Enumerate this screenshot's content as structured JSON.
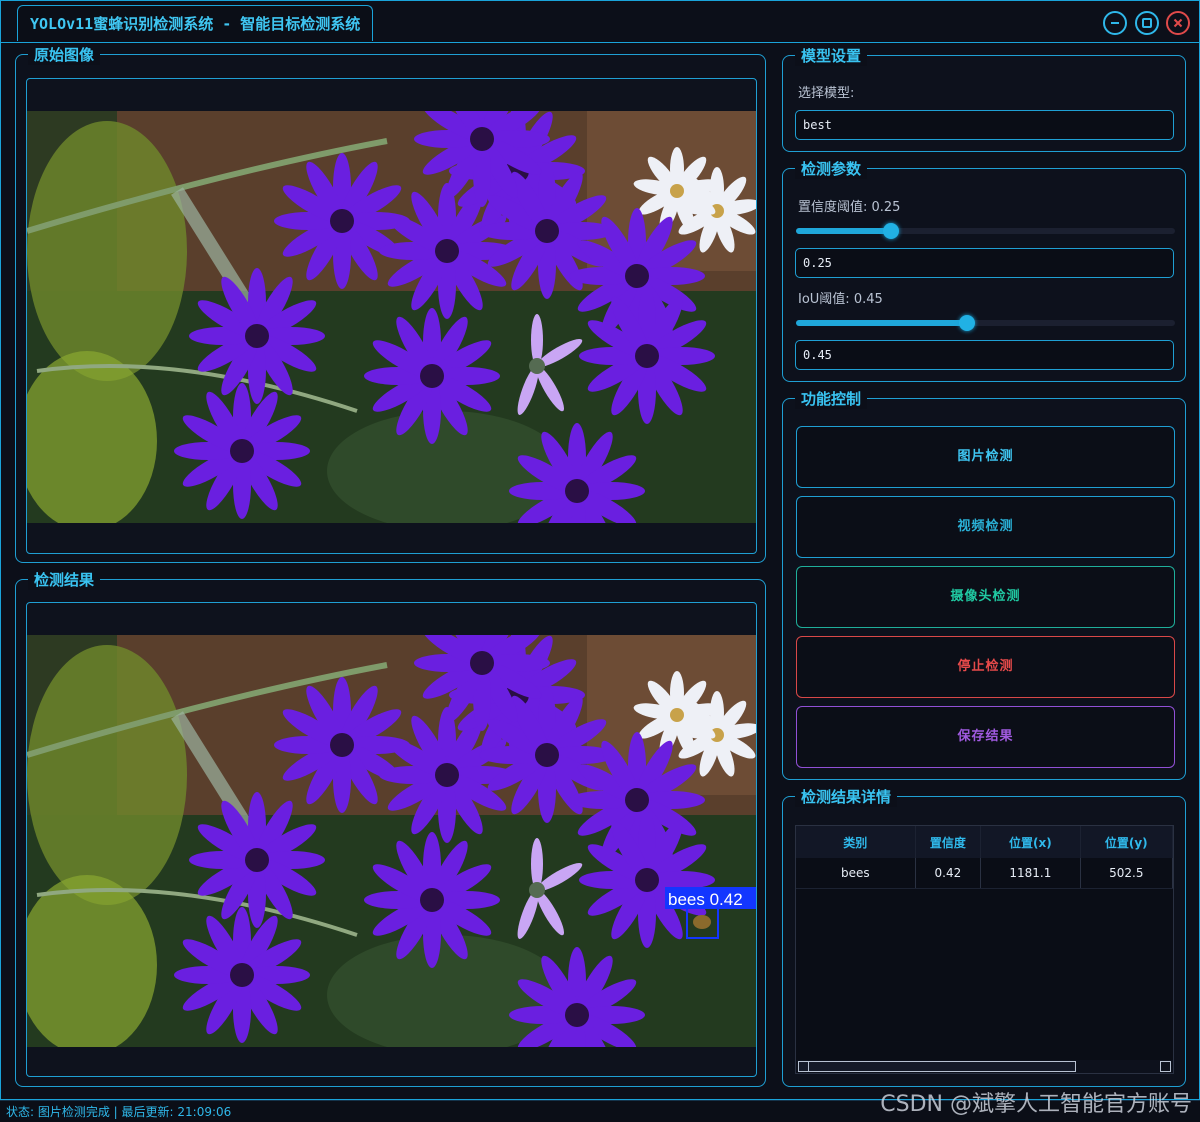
{
  "window": {
    "title": "YOLOv11蜜蜂识别检测系统 - 智能目标检测系统"
  },
  "original_panel": {
    "title": "原始图像"
  },
  "result_panel": {
    "title": "检测结果",
    "detection_label": "bees 0.42"
  },
  "model_settings": {
    "title": "模型设置",
    "select_label": "选择模型:",
    "model_value": "best"
  },
  "params": {
    "title": "检测参数",
    "conf_label": "置信度阈值: 0.25",
    "conf_value": "0.25",
    "conf_level": 0.25,
    "iou_label": "IoU阈值: 0.45",
    "iou_value": "0.45",
    "iou_level": 0.45
  },
  "controls": {
    "title": "功能控制",
    "image_detect": "图片检测",
    "video_detect": "视频检测",
    "camera_detect": "摄像头检测",
    "stop_detect": "停止检测",
    "save_result": "保存结果"
  },
  "details": {
    "title": "检测结果详情",
    "columns": [
      "类别",
      "置信度",
      "位置(x)",
      "位置(y)"
    ],
    "rows": [
      {
        "cls": "bees",
        "conf": "0.42",
        "x": "1181.1",
        "y": "502.5"
      }
    ]
  },
  "status": {
    "text": "状态: 图片检测完成 | 最后更新: 21:09:06"
  },
  "watermark": "CSDN @斌擎人工智能官方账号",
  "colors": {
    "accent": "#1aa3d9",
    "image_btn": "#3fc6f2",
    "video_btn": "#2ab0d6",
    "camera_btn": "#20c9a2",
    "stop_btn": "#e64a4a",
    "save_btn": "#a05ae0"
  }
}
